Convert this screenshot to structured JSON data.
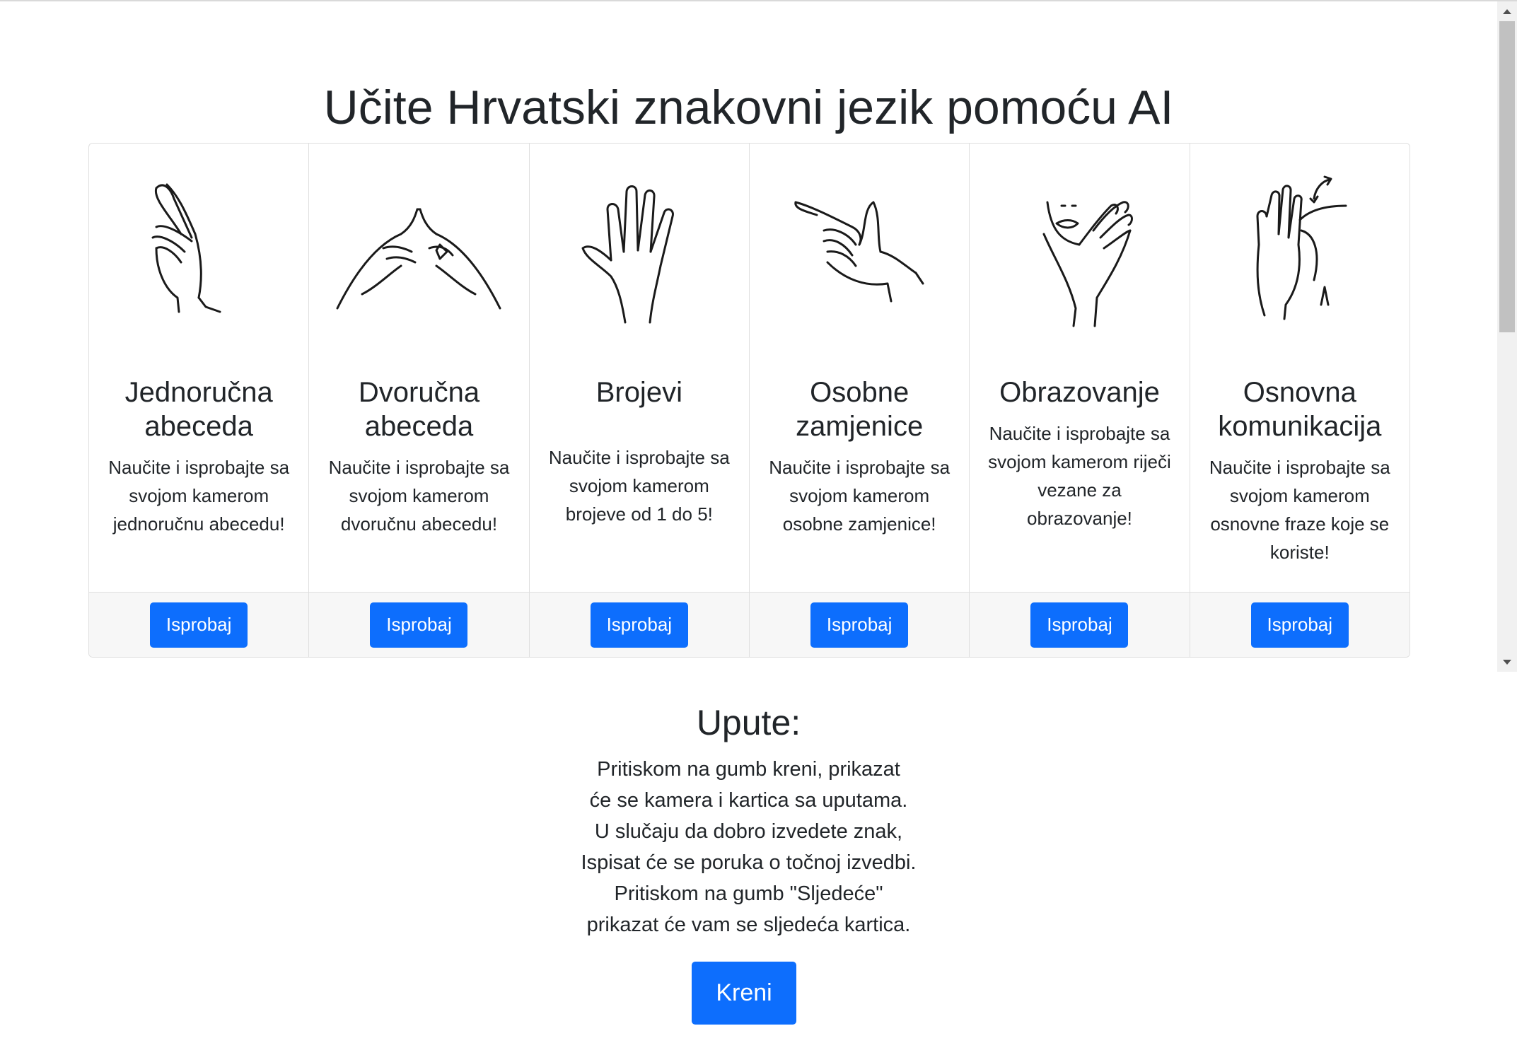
{
  "page": {
    "title": "Učite Hrvatski znakovni jezik pomoću AI"
  },
  "cards": [
    {
      "icon": "one-hand-alphabet-icon",
      "title": "Jednoručna abeceda",
      "text": "Naučite i isprobajte sa svojom kamerom jednoručnu abecedu!",
      "button": "Isprobaj"
    },
    {
      "icon": "two-hand-alphabet-icon",
      "title": "Dvoručna abeceda",
      "text": "Naučite i isprobajte sa svojom kamerom dvoručnu abecedu!",
      "button": "Isprobaj"
    },
    {
      "icon": "open-hand-numbers-icon",
      "title": "Brojevi",
      "text": "Naučite i isprobajte sa svojom kamerom brojeve od 1 do 5!",
      "button": "Isprobaj"
    },
    {
      "icon": "pointing-hands-icon",
      "title": "Osobne zamjenice",
      "text": "Naučite i isprobajte sa svojom kamerom osobne zamjenice!",
      "button": "Isprobaj"
    },
    {
      "icon": "hand-on-chin-icon",
      "title": "Obrazovanje",
      "text": "Naučite i isprobajte sa svojom kamerom riječi vezane za obrazovanje!",
      "button": "Isprobaj"
    },
    {
      "icon": "gesture-arrow-hand-icon",
      "title": "Osnovna komunikacija",
      "text": "Naučite i isprobajte sa svojom kamerom osnovne fraze koje se koriste!",
      "button": "Isprobaj"
    }
  ],
  "instructions": {
    "title": "Upute:",
    "lines": [
      "Pritiskom na gumb kreni, prikazat",
      "će se kamera i kartica sa uputama.",
      "U slučaju da dobro izvedete znak,",
      "Ispisat će se poruka o točnoj izvedbi.",
      "Pritiskom na gumb \"Sljedeće\"",
      "prikazat će vam se sljedeća kartica."
    ],
    "start_button": "Kreni"
  },
  "colors": {
    "primary": "#0d6efd",
    "text": "#212529",
    "footer_bg": "#f7f7f7",
    "border": "#dfdfdf"
  }
}
